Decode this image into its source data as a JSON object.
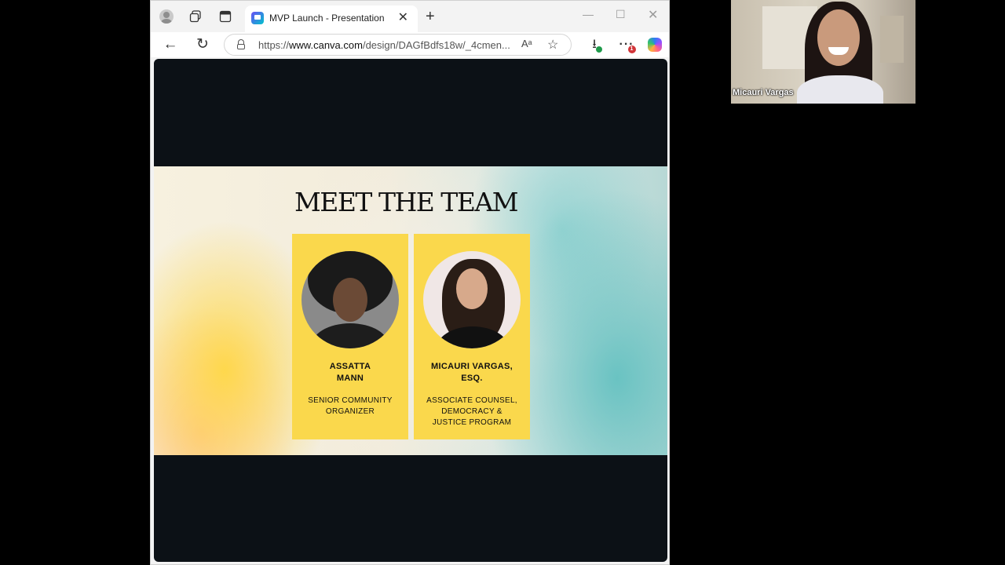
{
  "browser": {
    "tab": {
      "title": "MVP Launch - Presentation",
      "close": "✕"
    },
    "new_tab": "+",
    "window_controls": {
      "minimize": "—",
      "maximize": "☐",
      "close": "✕"
    },
    "toolbar": {
      "back": "←",
      "reload": "↻",
      "url_prefix": "https://",
      "url_domain": "www.canva.com",
      "url_rest": "/design/DAGfBdfs18w/_4cmen...",
      "read_aloud": "Aᵃ",
      "favorite": "☆",
      "downloads": "⭳",
      "more": "···",
      "more_badge": "1"
    }
  },
  "slide": {
    "title": "MEET THE TEAM",
    "members": [
      {
        "name_line1": "ASSATTA",
        "name_line2": "MANN",
        "role_line1": "SENIOR COMMUNITY",
        "role_line2": "ORGANIZER",
        "role_line3": ""
      },
      {
        "name_line1": "MICAURI VARGAS,",
        "name_line2": "ESQ.",
        "role_line1": "ASSOCIATE COUNSEL,",
        "role_line2": "DEMOCRACY &",
        "role_line3": "JUSTICE PROGRAM"
      }
    ]
  },
  "video": {
    "participant_name": "Micauri Vargas"
  },
  "colors": {
    "card": "#fad84c",
    "content_bg": "#0c1116",
    "page_bg": "#000000"
  },
  "icons": [
    "profile-icon",
    "collections-icon",
    "tab-actions-icon",
    "canva-favicon",
    "lock-icon",
    "read-aloud-icon",
    "star-icon",
    "downloads-icon",
    "more-icon",
    "copilot-icon"
  ]
}
